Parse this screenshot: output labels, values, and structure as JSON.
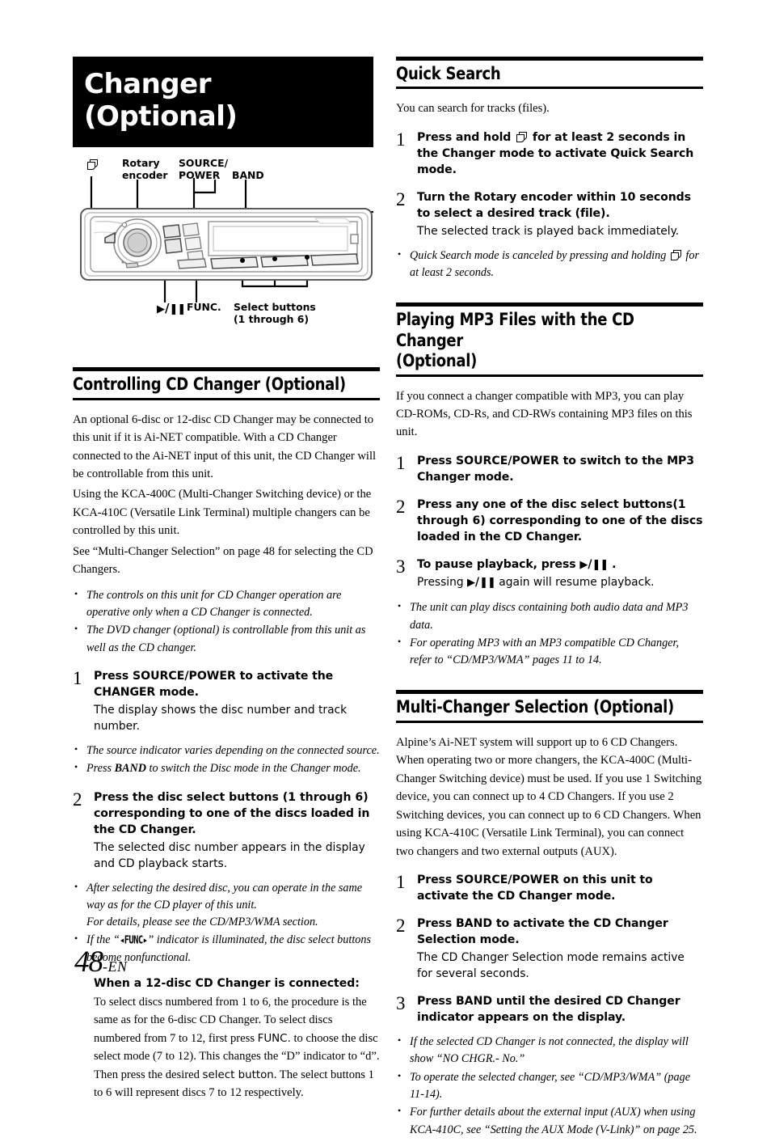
{
  "chapter": {
    "title_lines": [
      "Changer",
      "(Optional)"
    ]
  },
  "figure": {
    "labels": {
      "disc_icon": "disc-stack-icon",
      "rotary_encoder": [
        "Rotary",
        "encoder"
      ],
      "source_power": [
        "SOURCE/",
        "POWER"
      ],
      "band": "BAND",
      "play_pause": "▶/❙❙",
      "func": "FUNC.",
      "select_buttons": [
        "Select buttons",
        "(1 through 6)"
      ]
    }
  },
  "left_column": {
    "section1": {
      "heading": "Controlling CD Changer (Optional)",
      "paragraphs": [
        "An optional 6-disc or 12-disc CD Changer may be connected to this unit if it is Ai-NET compatible. With a CD Changer connected to the Ai-NET input of this unit, the CD Changer will be controllable from this unit.",
        "Using the KCA-400C (Multi-Changer Switching device) or the KCA-410C (Versatile Link Terminal) multiple changers can be controlled by this unit.",
        "See “Multi-Changer Selection” on page 48 for selecting the CD Changers."
      ],
      "notes_a": [
        "The controls on this unit for CD Changer operation are operative only when a CD Changer is connected.",
        "The DVD changer (optional) is controllable from this unit as well as the CD changer."
      ],
      "step1": {
        "num": "1",
        "lead_pre": "Press ",
        "lead_kb": "SOURCE/POWER",
        "lead_post": " to activate the CHANGER mode.",
        "sub": "The display shows the disc number and track number."
      },
      "notes_b_1": "The source indicator varies depending on the connected source.",
      "notes_b_2_pre": "Press ",
      "notes_b_2_kb": "BAND",
      "notes_b_2_post": " to switch the Disc mode in the Changer mode.",
      "step2": {
        "num": "2",
        "lead_pre": "Press the disc ",
        "lead_kb": "select buttons (1 through 6)",
        "lead_post": " corresponding to one of the discs loaded in the CD Changer.",
        "sub": "The selected disc number appears in the display and CD playback starts."
      },
      "notes_c_1_line1": "After selecting the desired disc, you can operate in the same way as for the CD player of this unit.",
      "notes_c_1_line2": "For details, please see the CD/MP3/WMA section.",
      "notes_c_2_pre": "If the “",
      "notes_c_2_lcd": "◂FUNC▸",
      "notes_c_2_post": "” indicator is illuminated, the disc select buttons become nonfunctional.",
      "inset": {
        "heading": "When a 12-disc CD Changer is connected:",
        "text_1": "To select discs numbered from 1 to 6, the procedure is the same as for the 6-disc CD Changer. To select discs numbered from 7 to 12, first press ",
        "func_label": "FUNC.",
        "text_2": " to choose the disc select mode (7 to 12). This changes the “D” indicator to “d”. Then press the desired ",
        "select_label": "select button",
        "text_3": ". The select buttons 1 to 6 will represent discs 7 to 12 respectively."
      }
    }
  },
  "right_column": {
    "section_quick_search": {
      "heading": "Quick Search",
      "intro": "You can search for tracks (files).",
      "step1": {
        "num": "1",
        "lead_pre": "Press and hold ",
        "lead_post": " for at least 2 seconds in the Changer mode to activate Quick Search mode."
      },
      "step2": {
        "num": "2",
        "lead_pre": "Turn the ",
        "lead_kb": "Rotary encoder",
        "lead_post": " within 10 seconds to select a desired track (file).",
        "sub": "The selected track is played back immediately."
      },
      "note_pre": "Quick Search mode is canceled by pressing and holding ",
      "note_post": " for at least 2 seconds."
    },
    "section_mp3": {
      "heading_lines": [
        "Playing MP3 Files with the CD Changer",
        "(Optional)"
      ],
      "intro": "If you connect a changer compatible with MP3, you can play CD-ROMs, CD-Rs, and CD-RWs containing MP3 files on this unit.",
      "step1": {
        "num": "1",
        "lead_pre": "Press ",
        "lead_kb": "SOURCE/POWER",
        "lead_post": " to switch to the MP3 Changer mode."
      },
      "step2": {
        "num": "2",
        "lead_pre": "Press any one of the disc ",
        "lead_kb": "select buttons(1 through 6)",
        "lead_post": " corresponding to one of the discs loaded in the CD Changer."
      },
      "step3": {
        "num": "3",
        "lead_pre": "To pause playback, press ",
        "lead_post": " .",
        "sub_pre": "Pressing ",
        "sub_post": " again will resume playback."
      },
      "notes": [
        "The unit can play discs containing both audio data and MP3 data.",
        "For operating MP3 with an MP3 compatible CD Changer, refer to “CD/MP3/WMA” pages 11 to 14."
      ]
    },
    "section_multi_changer": {
      "heading": "Multi-Changer Selection (Optional)",
      "intro": "Alpine’s Ai-NET system will support up to 6 CD Changers. When operating two or more changers, the KCA-400C (Multi-Changer Switching device) must be used. If you use 1 Switching device, you can connect up to 4 CD Changers. If you use 2 Switching devices, you can connect up to 6 CD Changers. When using KCA-410C (Versatile Link Terminal), you can connect two changers and two external outputs (AUX).",
      "step1": {
        "num": "1",
        "lead_pre": "Press ",
        "lead_kb": "SOURCE/POWER",
        "lead_post": " on this unit to activate the CD Changer mode."
      },
      "step2": {
        "num": "2",
        "lead_pre": "Press ",
        "lead_kb": "BAND",
        "lead_post": " to activate the CD Changer Selection mode.",
        "sub": "The CD Changer Selection mode remains active for several seconds."
      },
      "step3": {
        "num": "3",
        "lead_pre": "Press ",
        "lead_kb": "BAND",
        "lead_post": " until the desired CD Changer indicator appears on the display."
      },
      "notes": [
        "If the selected CD Changer is not connected, the display will show “NO CHGR.- No.”",
        "To operate the selected changer, see “CD/MP3/WMA” (page 11-14).",
        "For further details about the external input (AUX) when using KCA-410C, see “Setting the AUX Mode (V-Link)” on page 25."
      ]
    }
  },
  "footer": {
    "page_number": "48",
    "lang_suffix": "-EN"
  }
}
